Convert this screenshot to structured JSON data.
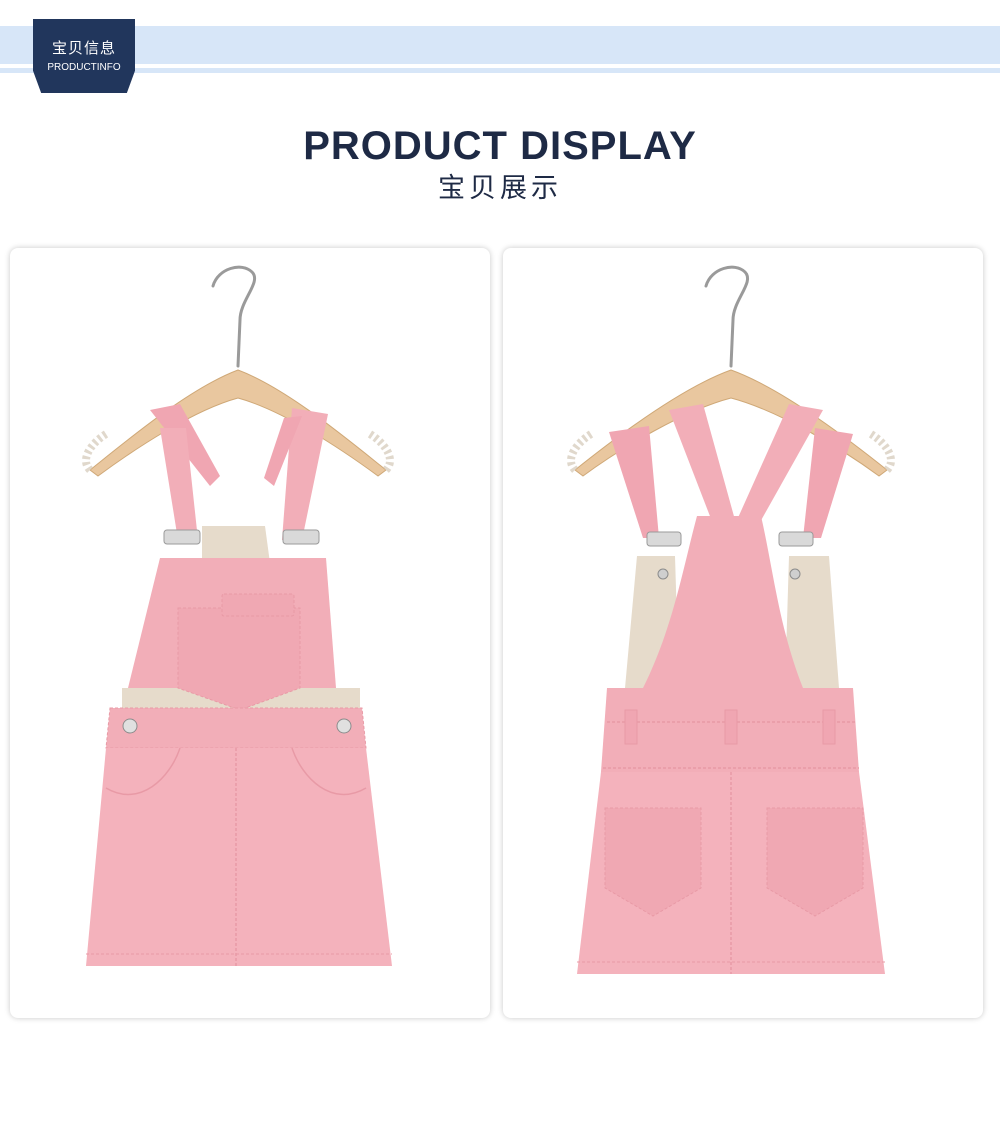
{
  "header": {
    "badge_cn": "宝贝信息",
    "badge_en": "PRODUCTINFO"
  },
  "section": {
    "title_en": "PRODUCT DISPLAY",
    "title_cn": "宝贝展示"
  },
  "colors": {
    "band": "#d7e6f8",
    "badge": "#21365c",
    "title": "#1e2a45",
    "garment_pink": "#f2aeb8",
    "lining_beige": "#e6dbcb",
    "hanger_wood": "#e9c79f"
  },
  "images": {
    "front": "pink-overall-dress-front-photo",
    "back": "pink-overall-dress-back-photo"
  }
}
